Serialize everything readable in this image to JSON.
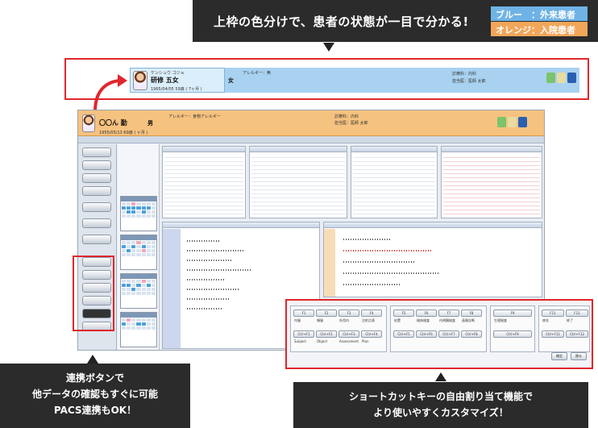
{
  "top_banner": {
    "title": "上枠の色分けで、患者の状態が一目で分かる!",
    "legend_blue": "ブルー　：外来患者",
    "legend_orange": "オレンジ：入院患者"
  },
  "blue_header": {
    "kana": "ケンシュウ ゴジョ",
    "name": "研修 五女",
    "sex": "女",
    "age_line": "1965/04/05  59歳 ( 7ヶ月 )",
    "allergy_label": "アレルギー：無",
    "ward_label": "診療科：内科",
    "doctor_label": "担当医：医師 太郎"
  },
  "orange_header": {
    "name": "〇〇ん 勤",
    "sex": "男",
    "age_line": "1955/05/13  69歳 ( ヶ月 )",
    "allergy_label": "アレルギー：食物アレルギー",
    "ward_label": "診療科：内科",
    "doctor_label": "担当医：医師 太郎"
  },
  "shortcuts": {
    "groups": [
      {
        "keys": [
          "F1",
          "F2",
          "F3",
          "F4"
        ],
        "labels": [
          "内服",
          "頓服",
          "外用内",
          "注射点滴"
        ],
        "ctrl_keys": [
          "Ctrl+F1",
          "Ctrl+F2",
          "Ctrl+F3",
          "Ctrl+F4"
        ],
        "ctrl_labels": [
          "Subject",
          "Object",
          "Assessment",
          "Plan"
        ]
      },
      {
        "keys": [
          "F5",
          "F6",
          "F7",
          "F8"
        ],
        "labels": [
          "処置",
          "検体検査",
          "内視鏡検査",
          "画像診断"
        ],
        "ctrl_keys": [
          "Ctrl+F5",
          "Ctrl+F6",
          "Ctrl+F7",
          "Ctrl+F8"
        ],
        "ctrl_labels": [
          "",
          "",
          "",
          ""
        ]
      },
      {
        "keys": [
          "F9"
        ],
        "labels": [
          "生理検査"
        ],
        "ctrl_keys": [
          "Ctrl+F9"
        ],
        "ctrl_labels": [
          ""
        ]
      },
      {
        "keys": [
          "F11",
          "F12"
        ],
        "labels": [
          "病名",
          "終了"
        ],
        "ctrl_keys": [
          "Ctrl+F11",
          "Ctrl+F12"
        ],
        "ctrl_labels": [
          "",
          ""
        ]
      }
    ],
    "ok_label": "確定",
    "close_label": "閉る"
  },
  "captions": {
    "left_line1": "連携ボタンで",
    "left_line2": "他データの確認もすぐに可能",
    "left_line3": "PACS連携もOK！",
    "right_line1": "ショートカットキーの自由割り当て機能で",
    "right_line2": "より使いやすくカスタマイズ！"
  },
  "colors": {
    "outpatient_blue": "#6fb3e6",
    "inpatient_orange": "#f2a65a",
    "highlight_red": "#e0262c"
  }
}
